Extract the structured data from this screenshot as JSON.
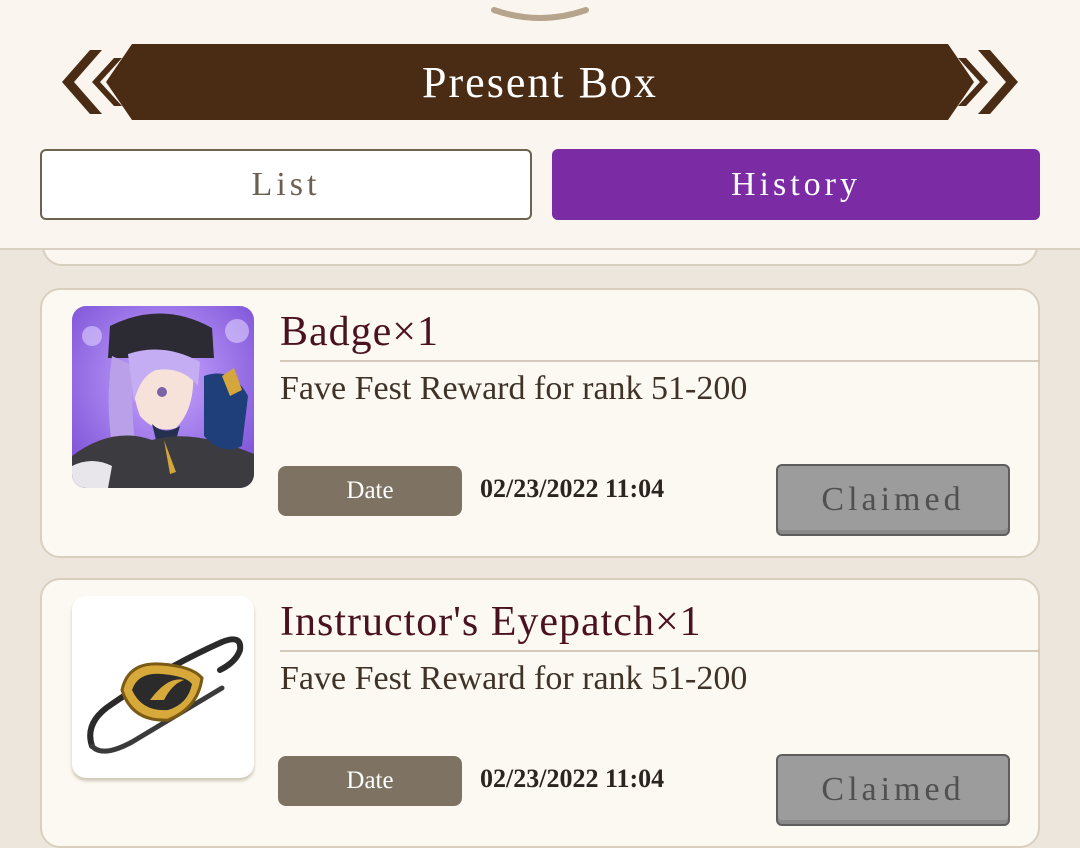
{
  "header": {
    "title": "Present Box",
    "tabs": [
      {
        "label": "List",
        "active": false
      },
      {
        "label": "History",
        "active": true
      }
    ]
  },
  "colors": {
    "banner": "#4a2c14",
    "active_tab": "#7b2ba3",
    "item_name": "#4a1220",
    "claimed_button": "#9c9c9c"
  },
  "presents": [
    {
      "name": "Badge×1",
      "description": "Fave Fest Reward for rank 51-200",
      "date_label": "Date",
      "date": "02/23/2022 11:04",
      "status": "Claimed",
      "icon": "character-portrait-icon"
    },
    {
      "name": "Instructor's Eyepatch×1",
      "description": "Fave Fest Reward for rank 51-200",
      "date_label": "Date",
      "date": "02/23/2022 11:04",
      "status": "Claimed",
      "icon": "eyepatch-icon"
    }
  ]
}
